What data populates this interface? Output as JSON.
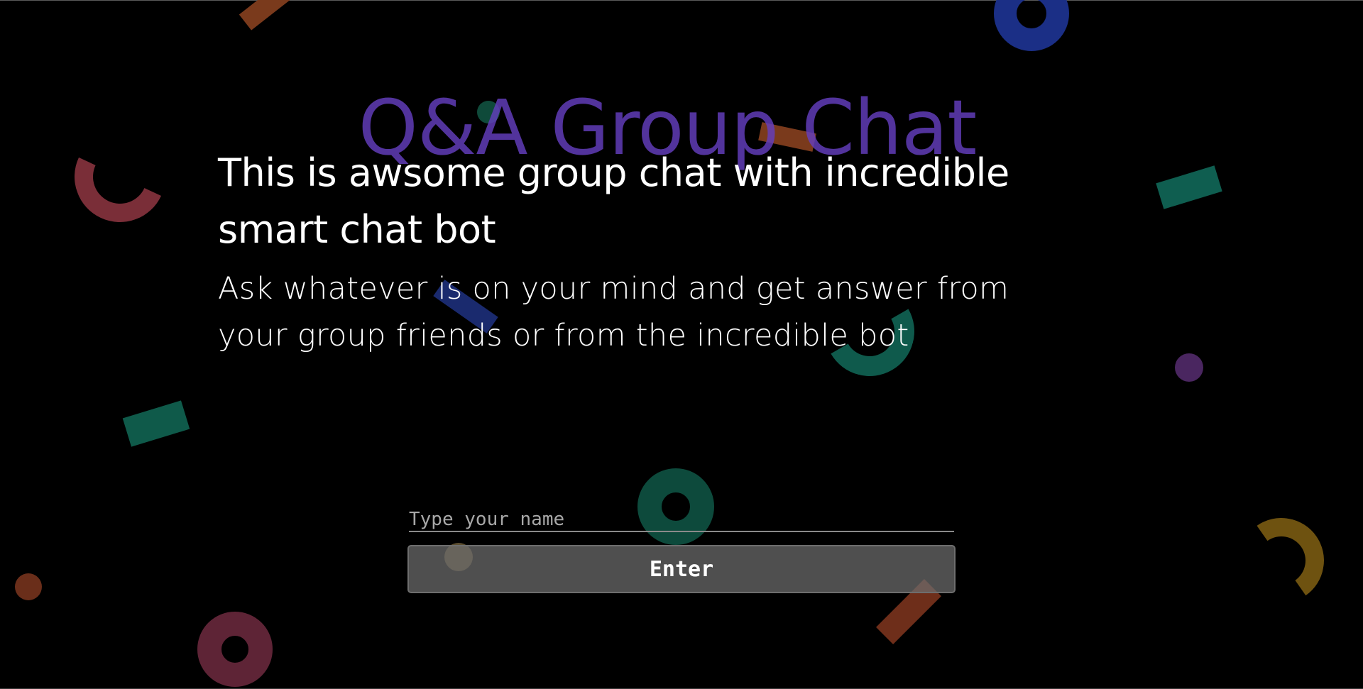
{
  "brand": {
    "title": "Q&A Group Chat"
  },
  "hero": {
    "headline": "This is awsome group chat with incredible smart chat bot",
    "subtitle": "Ask whatever is on your mind and get answer from your group friends or from the incredible bot"
  },
  "form": {
    "name_placeholder": "Type your name",
    "name_value": "",
    "enter_label": "Enter"
  },
  "colors": {
    "background": "#000000",
    "title_accent": "#643ebe",
    "text": "#ffffff",
    "button_bg": "#555555"
  }
}
